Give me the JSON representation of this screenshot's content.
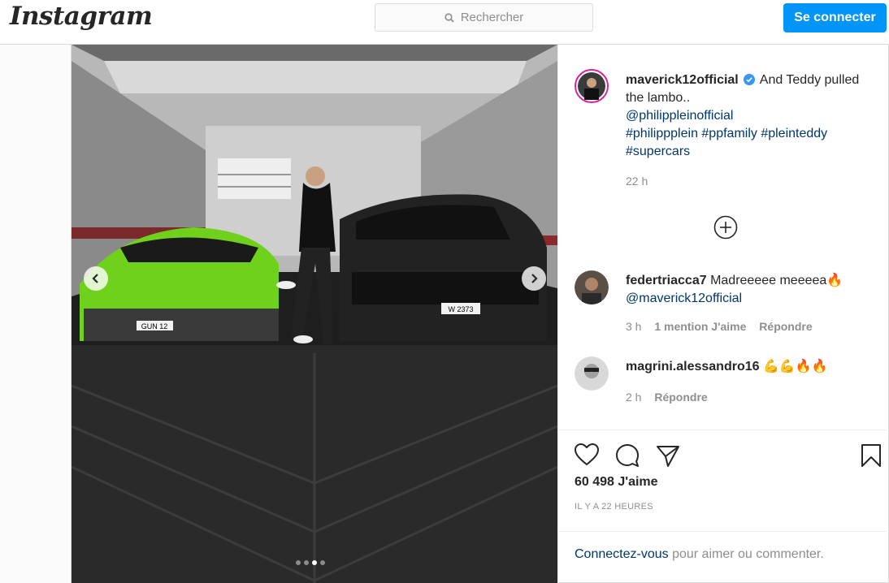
{
  "header": {
    "logo": "Instagram",
    "search_placeholder": "Rechercher",
    "login_label": "Se connecter"
  },
  "post": {
    "author": "maverick12official",
    "caption_text": "And Teddy pulled the lambo..",
    "caption_mention": "@philippleinofficial",
    "caption_hashtags": "#philippplein #ppfamily #pleinteddy #supercars",
    "caption_time": "22 h",
    "license_plate_left": "GUN 12",
    "license_plate_right": "W 2373",
    "carousel_total": 4,
    "carousel_active": 3
  },
  "comments": [
    {
      "user": "federtriacca7",
      "text": "Madreeeee meeeea🔥",
      "mention": "@maverick12official",
      "time": "3 h",
      "likes": "1 mention J'aime",
      "reply": "Répondre"
    },
    {
      "user": "magrini.alessandro16",
      "text": "💪💪🔥🔥",
      "time": "2 h",
      "reply": "Répondre"
    }
  ],
  "stats": {
    "likes": "60 498 J'aime",
    "posted": "IL Y A 22 HEURES"
  },
  "footer": {
    "login_link": "Connectez-vous",
    "login_suffix": " pour aimer ou commenter."
  }
}
